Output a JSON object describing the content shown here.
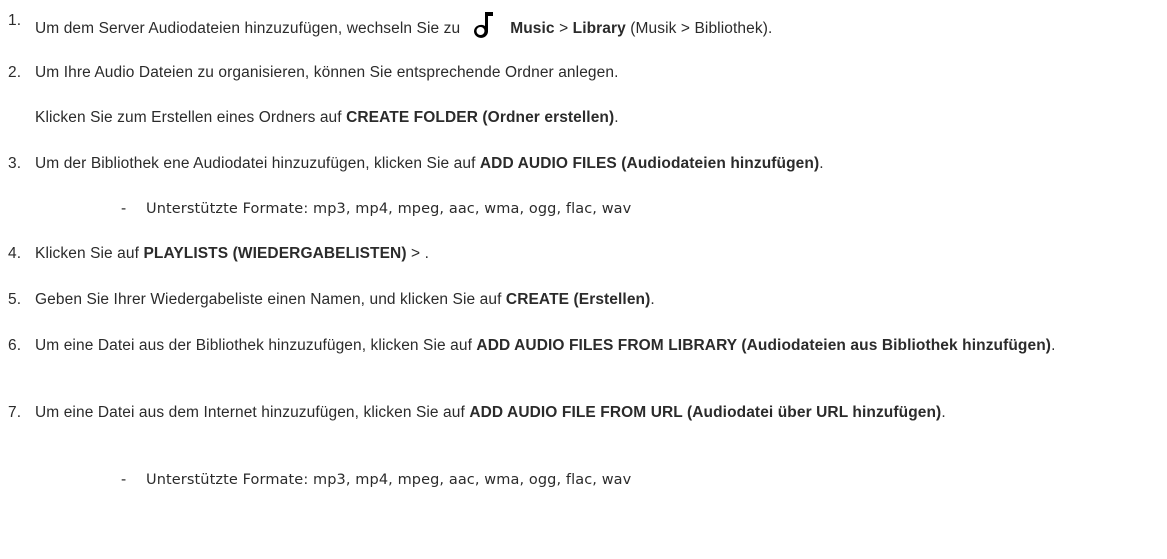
{
  "steps": [
    {
      "number": "1.",
      "pre": "Um dem Server Audiodateien hinzuzufügen, wechseln Sie zu",
      "icon": "music-note-icon",
      "bold1": "Music",
      "sep": " > ",
      "bold2": "Library",
      "post": " (Musik > Bibliothek)."
    },
    {
      "number": "2.",
      "text": "Um Ihre Audio Dateien zu organisieren, können Sie entsprechende Ordner anlegen."
    },
    {
      "pre": "Klicken Sie zum Erstellen eines Ordners auf ",
      "bold": "CREATE FOLDER (Ordner erstellen)",
      "post": "."
    },
    {
      "number": "3.",
      "pre": "Um der Bibliothek ene Audiodatei hinzuzufügen, klicken Sie auf ",
      "bold": "ADD AUDIO FILES (Audiodateien hinzufügen)",
      "post": "."
    },
    {
      "dash": "-",
      "text": "Unterstützte Formate: mp3, mp4, mpeg, aac, wma, ogg, flac, wav"
    },
    {
      "number": "4.",
      "pre": "Klicken Sie auf ",
      "bold": "PLAYLISTS (WIEDERGABELISTEN)",
      "post": " >  ."
    },
    {
      "number": "5.",
      "pre": "Geben Sie Ihrer Wiedergabeliste einen Namen, und klicken Sie auf ",
      "bold": "CREATE (Erstellen)",
      "post": "."
    },
    {
      "number": "6.",
      "pre": "Um eine Datei aus der Bibliothek hinzuzufügen, klicken Sie auf ",
      "bold": "ADD AUDIO FILES FROM LIBRARY (Audiodateien aus Bibliothek hinzufügen)",
      "post": "."
    },
    {
      "number": "7.",
      "pre": "Um eine Datei aus dem Internet hinzuzufügen, klicken Sie auf ",
      "bold": "ADD AUDIO FILE FROM URL (Audiodatei über URL hinzufügen)",
      "post": "."
    },
    {
      "dash": "-",
      "text": "Unterstützte Formate: mp3, mp4, mpeg, aac, wma, ogg, flac, wav"
    }
  ]
}
